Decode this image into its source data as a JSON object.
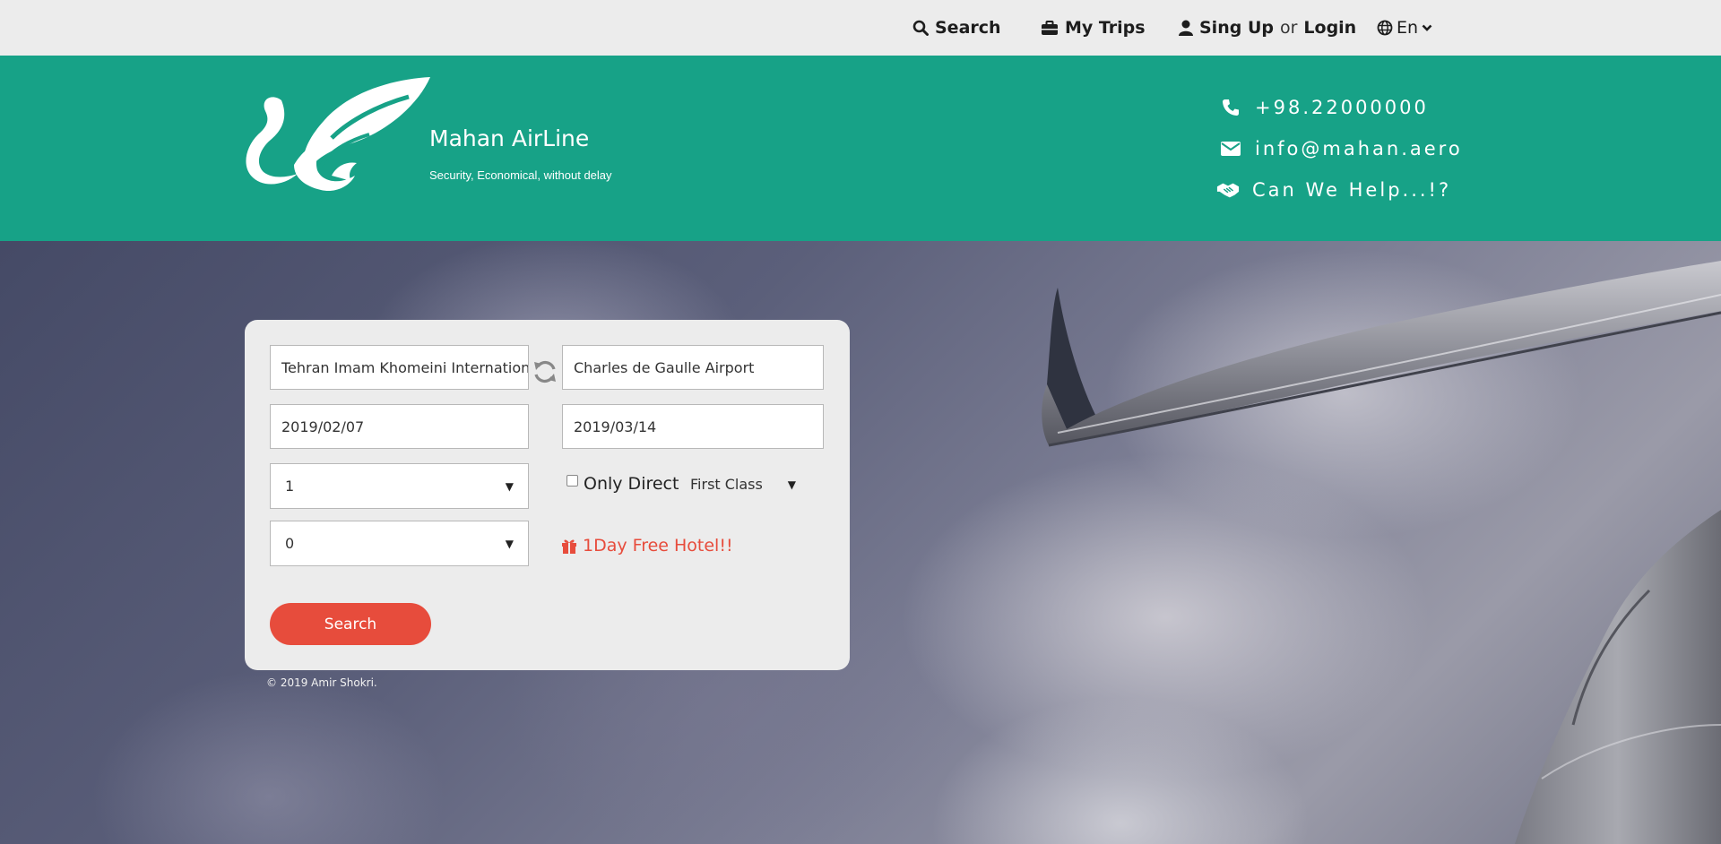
{
  "nav": {
    "search": "Search",
    "my_trips": "My Trips",
    "signup": "Sing Up",
    "or": "or",
    "login": "Login",
    "language": "En"
  },
  "header": {
    "brand": "Mahan AirLine",
    "tagline": "Security, Economical, without delay",
    "phone": "+98.22000000",
    "email": "info@mahan.aero",
    "help": "Can We Help...!?"
  },
  "form": {
    "origin": "Tehran Imam Khomeini International Airport",
    "destination": "Charles de Gaulle Airport",
    "depart_date": "2019/02/07",
    "return_date": "2019/03/14",
    "adults": "1",
    "children": "0",
    "only_direct_label": "Only Direct",
    "only_direct_checked": false,
    "class": "First Class",
    "promo": "1Day Free Hotel!!",
    "search_button": "Search"
  },
  "footer": {
    "copyright": "© 2019 Amir Shokri."
  },
  "colors": {
    "header_green": "#17a287",
    "accent_red": "#e74c3c",
    "nav_bg": "#ececec"
  }
}
